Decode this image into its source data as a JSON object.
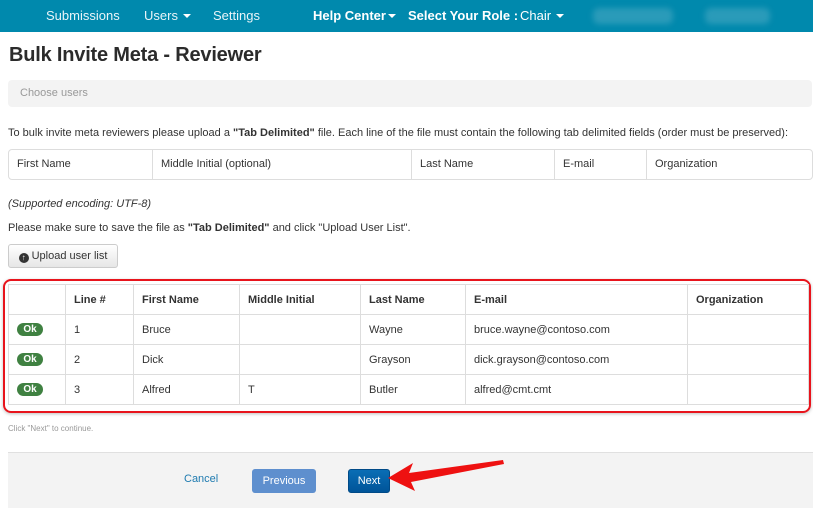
{
  "nav": {
    "items": [
      {
        "label": "Submissions",
        "dropdown": false
      },
      {
        "label": "Users",
        "dropdown": true
      },
      {
        "label": "Settings",
        "dropdown": false
      }
    ],
    "help_center": "Help Center",
    "role_label": "Select Your Role :",
    "role_value": "Chair"
  },
  "page": {
    "title": "Bulk Invite Meta - Reviewer",
    "choose_users": "Choose users"
  },
  "instructions": {
    "line1_pre": "To bulk invite meta reviewers please upload a ",
    "line1_bold": "\"Tab Delimited\"",
    "line1_post": " file. Each line of the file must contain the following tab delimited fields (order must be preserved):",
    "fields": [
      "First Name",
      "Middle Initial (optional)",
      "Last Name",
      "E-mail",
      "Organization"
    ],
    "encoding": "(Supported encoding: UTF-8)",
    "line2_pre": "Please make sure to save the file as ",
    "line2_bold": "\"Tab Delimited\"",
    "line2_post": " and click \"Upload User List\"."
  },
  "upload_button": {
    "icon": "upload-circle-icon",
    "label": "Upload user list"
  },
  "results": {
    "columns": [
      "",
      "Line #",
      "First Name",
      "Middle Initial",
      "Last Name",
      "E-mail",
      "Organization"
    ],
    "rows": [
      {
        "status": "Ok",
        "line": "1",
        "first": "Bruce",
        "middle": "",
        "last": "Wayne",
        "email": "bruce.wayne@contoso.com",
        "org": ""
      },
      {
        "status": "Ok",
        "line": "2",
        "first": "Dick",
        "middle": "",
        "last": "Grayson",
        "email": "dick.grayson@contoso.com",
        "org": ""
      },
      {
        "status": "Ok",
        "line": "3",
        "first": "Alfred",
        "middle": "T",
        "last": "Butler",
        "email": "alfred@cmt.cmt",
        "org": ""
      }
    ]
  },
  "hint": "Click \"Next\" to continue.",
  "footer": {
    "cancel": "Cancel",
    "previous": "Previous",
    "next": "Next"
  },
  "colors": {
    "nav_bg": "#0089ad",
    "ok_badge": "#3f8141",
    "highlight": "#e8141c",
    "next_btn": "#005499",
    "prev_btn": "#5e8fce",
    "link": "#1f7bb0"
  }
}
